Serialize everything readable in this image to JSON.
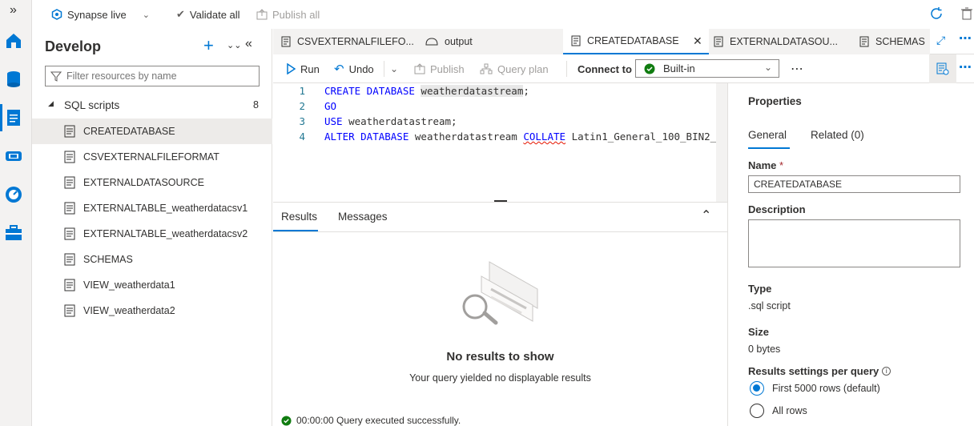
{
  "topbar": {
    "collapse_icon": "double-chevron-right-icon",
    "workspace_label": "Synapse live",
    "validate_label": "Validate all",
    "publish_label": "Publish all"
  },
  "develop": {
    "title": "Develop",
    "filter_placeholder": "Filter resources by name",
    "section_label": "SQL scripts",
    "section_count": "8",
    "items": [
      {
        "label": "CREATEDATABASE"
      },
      {
        "label": "CSVEXTERNALFILEFORMAT"
      },
      {
        "label": "EXTERNALDATASOURCE"
      },
      {
        "label": "EXTERNALTABLE_weatherdatacsv1"
      },
      {
        "label": "EXTERNALTABLE_weatherdatacsv2"
      },
      {
        "label": "SCHEMAS"
      },
      {
        "label": "VIEW_weatherdata1"
      },
      {
        "label": "VIEW_weatherdata2"
      }
    ]
  },
  "tabs": [
    {
      "label": "CSVEXTERNALFILEFO..."
    },
    {
      "label": "output"
    },
    {
      "label": "CREATEDATABASE"
    },
    {
      "label": "EXTERNALDATASOU..."
    },
    {
      "label": "SCHEMAS"
    }
  ],
  "editor_toolbar": {
    "run_label": "Run",
    "undo_label": "Undo",
    "publish_label": "Publish",
    "queryplan_label": "Query plan",
    "connect_label": "Connect to",
    "connect_value": "Built-in"
  },
  "code": {
    "lines": [
      {
        "num": "1",
        "kw1": "CREATE DATABASE ",
        "rest": "weatherdatastream",
        "tail": ";"
      },
      {
        "num": "2",
        "kw1": "GO",
        "rest": "",
        "tail": ""
      },
      {
        "num": "3",
        "kw1": "USE ",
        "rest": "weatherdatastream;",
        "tail": ""
      },
      {
        "num": "4",
        "kw1": "ALTER DATABASE ",
        "rest": "weatherdatastream ",
        "kw2": "COLLATE",
        "tail": " Latin1_General_100_BIN2_"
      }
    ]
  },
  "results": {
    "tab_results": "Results",
    "tab_messages": "Messages",
    "empty_title": "No results to show",
    "empty_subtitle": "Your query yielded no displayable results",
    "status": "00:00:00 Query executed successfully."
  },
  "properties": {
    "title": "Properties",
    "tab_general": "General",
    "tab_related": "Related (0)",
    "name_label": "Name",
    "name_required": "*",
    "name_value": "CREATEDATABASE",
    "description_label": "Description",
    "type_label": "Type",
    "type_value": ".sql script",
    "size_label": "Size",
    "size_value": "0 bytes",
    "results_settings_label": "Results settings per query",
    "option_first": "First 5000 rows (default)",
    "option_all": "All rows"
  },
  "colors": {
    "accent": "#0078d4",
    "success": "#107c10",
    "keyword": "#0000ff"
  }
}
